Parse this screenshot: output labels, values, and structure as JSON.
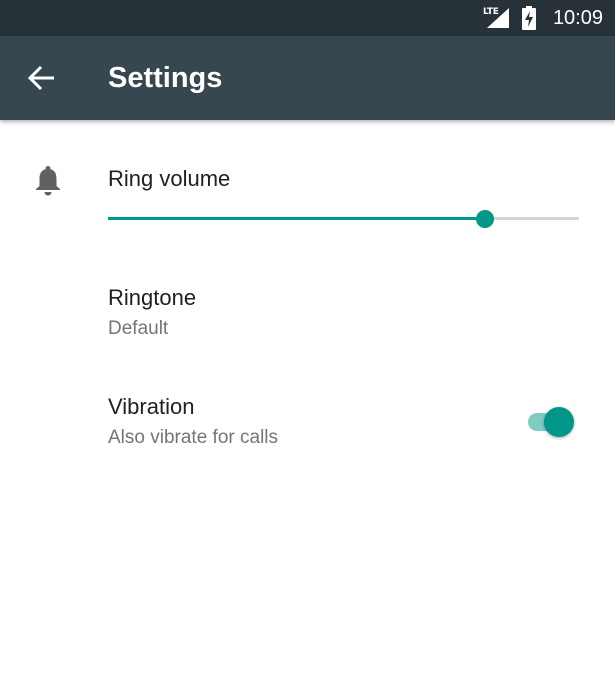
{
  "status_bar": {
    "network_label": "LTE",
    "time": "10:09",
    "icons": [
      "lte-signal-icon",
      "battery-charging-icon"
    ]
  },
  "app_bar": {
    "back_icon": "arrow-back-icon",
    "title": "Settings"
  },
  "settings": {
    "ring_volume": {
      "icon": "bell-icon",
      "label": "Ring volume",
      "level_fraction": 0.8
    },
    "ringtone": {
      "label": "Ringtone",
      "value": "Default"
    },
    "vibration": {
      "label": "Vibration",
      "description": "Also vibrate for calls",
      "enabled": true
    }
  },
  "colors": {
    "status_bar": "#263238",
    "app_bar": "#37474f",
    "accent": "#009688",
    "accent_light": "#80cbc4"
  }
}
